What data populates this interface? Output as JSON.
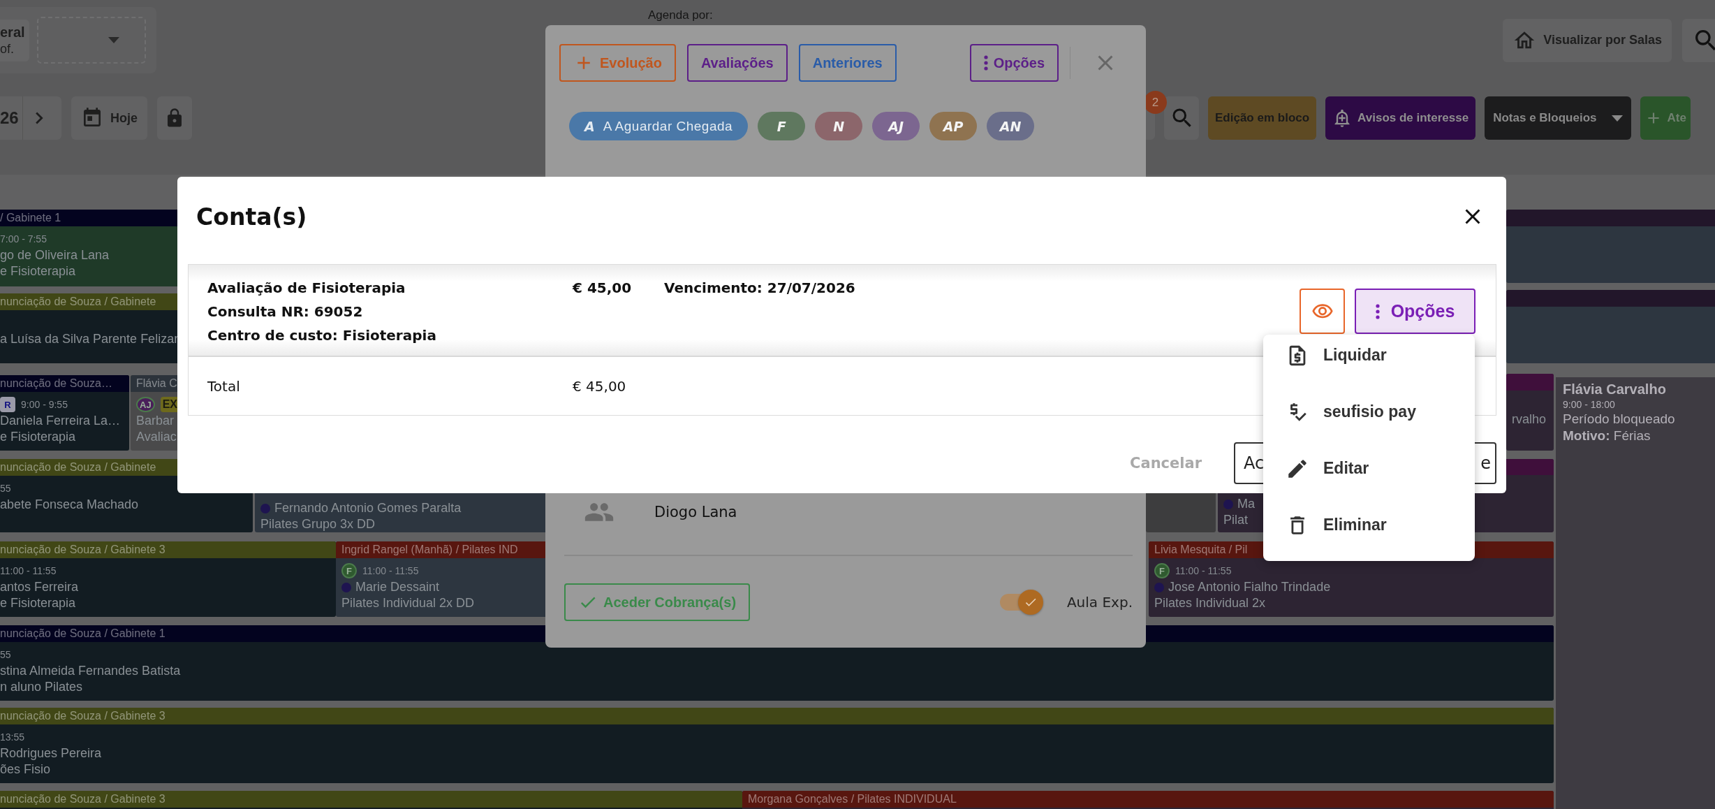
{
  "top_bar": {
    "view_label": [
      "eral",
      "of."
    ],
    "agenda_label": "Agenda por:",
    "rooms_button": "Visualizar por Salas"
  },
  "date_nav": {
    "date": "26",
    "today_button": "Hoje"
  },
  "actions": {
    "notification_count": "2",
    "bulk_edit_button": "Edição em bloco",
    "interest_button": "Avisos de interesse",
    "notes_dropdown": "Notas e Bloqueios",
    "add_button": "Ate"
  },
  "calendar": {
    "events": [
      {
        "header": "/ Gabinete 1",
        "color": "#03031f",
        "time": "7:00 - 7:55",
        "dot": false,
        "lines": [
          "go de Oliveira Lana",
          "e Fisioterapia"
        ]
      },
      {
        "color": "#22162a",
        "dot": false
      },
      {
        "header": "nunciação de Souza / Gabinete",
        "color": "#414716",
        "dot": false,
        "lines": [
          "a Luísa da Silva Parente Felizar"
        ]
      },
      {
        "color": "#22162a",
        "dot": false
      },
      {
        "header": "nunciação de Souza…",
        "color": "#03031f",
        "badges": [
          {
            "kind": "square",
            "text": "R"
          }
        ],
        "time": "9:00 - 9:55",
        "dot": false,
        "lines": [
          "Daniela Ferreira La…",
          "e Fisioterapia"
        ]
      },
      {
        "header": "Flávia C",
        "color": "#2c333b",
        "badges": [
          {
            "kind": "circle",
            "text": "AJ",
            "color": "#4a1f5a"
          },
          {
            "kind": "tag",
            "text": "EX"
          }
        ],
        "dot": false,
        "lines": [
          "Barbar",
          "Avaliac"
        ]
      },
      {
        "color": "#3f0f3b",
        "dot": false,
        "lines": [
          "rvalho"
        ]
      },
      {
        "header": "nunciação de Souza / Gabinete",
        "color": "#414716",
        "time": "55",
        "dot": false,
        "lines": [
          "abete Fonseca Machado"
        ]
      },
      {
        "dot": true,
        "lines": [
          "Fernando Antonio Gomes Paralta",
          "Pilates Grupo 3x DD"
        ]
      },
      {
        "dot": false
      },
      {
        "color": "#3f0f3b",
        "dot": true,
        "lines": [
          "Ma",
          "Pilat"
        ]
      },
      {
        "header": "nunciação de Souza / Gabinete 3",
        "color": "#414716",
        "time": "11:00 - 11:55",
        "dot": false,
        "lines": [
          "antos Ferreira",
          "e Fisioterapia"
        ]
      },
      {
        "header": "Ingrid Rangel (Manhã) / Pilates IND",
        "color": "#58160f",
        "badges": [
          {
            "kind": "circle",
            "text": "F",
            "color": "#2f5a2f"
          }
        ],
        "time": "11:00 - 11:55",
        "dot": true,
        "lines": [
          "Marie Dessaint",
          "Pilates Individual 2x DD"
        ]
      },
      {
        "header": "Livia Mesquita / Pil",
        "color": "#58160f",
        "badges": [
          {
            "kind": "circle",
            "text": "F",
            "color": "#2f5a2f"
          }
        ],
        "time": "11:00 - 11:55",
        "dot": true,
        "lines": [
          "Jose Antonio Fialho Trindade",
          "Pilates Individual 2x"
        ]
      },
      {
        "header": "nunciação de Souza / Gabinete 1",
        "color": "#03031f",
        "time": "55",
        "dot": false,
        "lines": [
          "stina Almeida Fernandes Batista",
          "n aluno Pilates"
        ]
      },
      {
        "header": "nunciação de Souza / Gabinete 3",
        "color": "#414716",
        "time": "13:55",
        "dot": false,
        "lines": [
          "Rodrigues Pereira",
          "ões Fisio"
        ]
      },
      {
        "header": "nunciação de Souza / Gabinete 3",
        "color": "#414716",
        "dot": false
      },
      {
        "header": "Morgana Gonçalves / Pilates INDIVIDUAL",
        "color": "#58160f",
        "dot": false
      }
    ],
    "blocked": {
      "professional": "Flávia Carvalho",
      "time": "9:00 - 18:00",
      "status": "Período bloqueado",
      "reason": "**Motivo:** Férias"
    }
  },
  "appointment_dialog": {
    "buttons": [
      {
        "kind": "add",
        "label": "Evolução",
        "color": "#c0561e"
      },
      {
        "kind": "plain",
        "label": "Avaliações",
        "color": "#5c1f88"
      },
      {
        "kind": "plain",
        "label": "Anteriores",
        "color": "#2a5ca8"
      }
    ],
    "options_button": "Opções",
    "status_chips": [
      {
        "letter": "A",
        "label": "A Aguardar Chegada",
        "selected": true,
        "color": "#4a78a8"
      },
      {
        "letter": "F",
        "selected": false,
        "color": "#5f785f"
      },
      {
        "letter": "N",
        "selected": false,
        "color": "#8c666b"
      },
      {
        "letter": "AJ",
        "selected": false,
        "color": "#7c6690"
      },
      {
        "letter": "AP",
        "selected": false,
        "color": "#8f7350"
      },
      {
        "letter": "AN",
        "selected": false,
        "color": "#6a6e8a"
      }
    ],
    "professional": "Diogo Lana",
    "charges_button": "Aceder Cobrança(s)",
    "trial_class": {
      "label": "Aula Exp.",
      "on": true
    }
  },
  "accounts_dialog": {
    "title": "Conta(s)",
    "rows": [
      {
        "description": [
          "Avaliação de Fisioterapia",
          "Consulta NR: 69052",
          "Centro de custo: Fisioterapia"
        ],
        "amount": "€ 45,00",
        "due": "Vencimento: 27/07/2026"
      }
    ],
    "total": {
      "label": "Total",
      "amount": "€ 45,00"
    },
    "options_button": "Opções",
    "cancel_button": "Cancelar",
    "confirm_button": {
      "visible_start": "Ac",
      "visible_end": "e"
    }
  },
  "options_menu": {
    "items": [
      {
        "kind": "settle",
        "label": "Liquidar"
      },
      {
        "kind": "pay",
        "label": "seufisio pay"
      },
      {
        "kind": "edit",
        "label": "Editar"
      },
      {
        "kind": "delete",
        "label": "Eliminar"
      }
    ]
  }
}
